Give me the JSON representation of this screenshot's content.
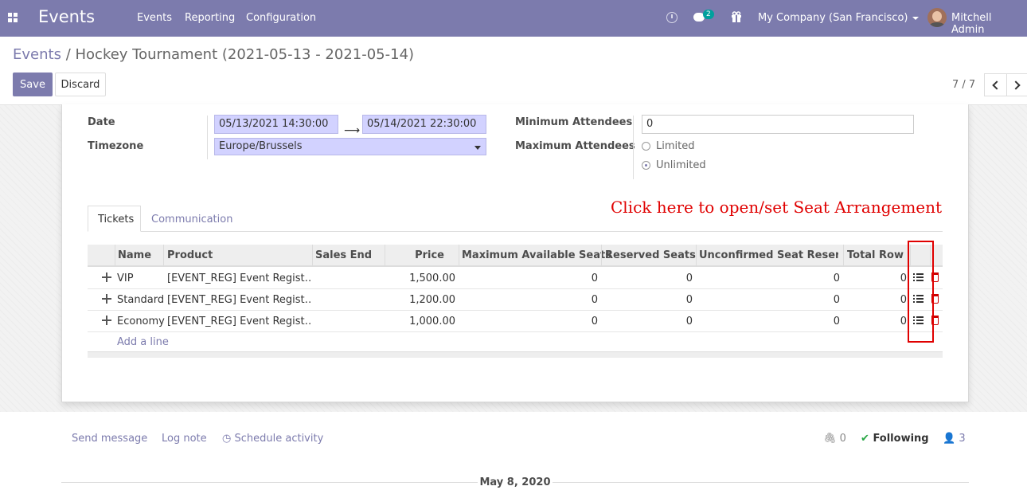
{
  "navbar": {
    "app_name": "Events",
    "menu": [
      "Events",
      "Reporting",
      "Configuration"
    ],
    "messages_count": "2",
    "company": "My Company (San Francisco)",
    "user": "Mitchell Admin",
    "color": "#7c7bad"
  },
  "breadcrumb": {
    "parent": "Events",
    "separator": "/",
    "current": "Hockey Tournament (2021-05-13 - 2021-05-14)"
  },
  "actions": {
    "save": "Save",
    "discard": "Discard"
  },
  "pager": {
    "value": "7 / 7"
  },
  "form": {
    "date_label": "Date",
    "date_begin": "05/13/2021 14:30:00",
    "date_end": "05/14/2021 22:30:00",
    "timezone_label": "Timezone",
    "timezone": "Europe/Brussels",
    "min_attendees_label": "Minimum Attendees",
    "min_attendees": "0",
    "max_attendees_label": "Maximum Attendees",
    "max_options": [
      {
        "label": "Limited",
        "checked": false
      },
      {
        "label": "Unlimited",
        "checked": true
      }
    ]
  },
  "annotation": "Click here to open/set Seat Arrangement",
  "tabs": [
    {
      "label": "Tickets",
      "active": true
    },
    {
      "label": "Communication",
      "active": false
    }
  ],
  "tickets": {
    "columns": [
      "Name",
      "Product",
      "Sales End",
      "Price",
      "Maximum Available Seats",
      "Reserved Seats",
      "Unconfirmed Seat Reserv…",
      "Total Row"
    ],
    "rows": [
      {
        "name": "VIP",
        "product": "[EVENT_REG] Event Regist…",
        "sales_end": "",
        "price": "1,500.00",
        "max_seats": "0",
        "reserved": "0",
        "unconfirmed": "0",
        "total_row": "0"
      },
      {
        "name": "Standard",
        "product": "[EVENT_REG] Event Regist…",
        "sales_end": "",
        "price": "1,200.00",
        "max_seats": "0",
        "reserved": "0",
        "unconfirmed": "0",
        "total_row": "0"
      },
      {
        "name": "Economy",
        "product": "[EVENT_REG] Event Regist…",
        "sales_end": "",
        "price": "1,000.00",
        "max_seats": "0",
        "reserved": "0",
        "unconfirmed": "0",
        "total_row": "0"
      }
    ],
    "add_line": "Add a line"
  },
  "chatter": {
    "send_message": "Send message",
    "log_note": "Log note",
    "schedule_activity": "Schedule activity",
    "attachments": "0",
    "following": "Following",
    "followers": "3",
    "date_separator": "May 8, 2020"
  }
}
